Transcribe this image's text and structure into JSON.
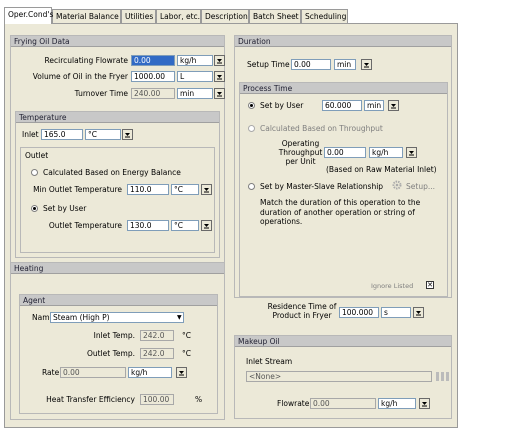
{
  "tabs": [
    "Oper.Cond's",
    "Material Balance",
    "Utilities",
    "Labor, etc.",
    "Description",
    "Batch Sheet",
    "Scheduling"
  ],
  "frying_oil": {
    "title": "Frying Oil Data",
    "recirc_label": "Recirculating Flowrate",
    "recirc_value": "0.00",
    "recirc_unit": "kg/h",
    "volume_label": "Volume of Oil in the Fryer",
    "volume_value": "1000.00",
    "volume_unit": "L",
    "turnover_label": "Turnover Time",
    "turnover_value": "240.00",
    "turnover_unit": "min"
  },
  "temperature": {
    "title": "Temperature",
    "inlet_label": "Inlet",
    "inlet_value": "165.0",
    "inlet_unit": "°C",
    "outlet_title": "Outlet",
    "calc_label": "Calculated Based on Energy Balance",
    "min_outlet_label": "Min Outlet Temperature",
    "min_outlet_value": "110.0",
    "min_outlet_unit": "°C",
    "set_user_label": "Set by User",
    "outlet_temp_label": "Outlet Temperature",
    "outlet_temp_value": "130.0",
    "outlet_temp_unit": "°C"
  },
  "heating": {
    "title": "Heating",
    "agent_title": "Agent",
    "name_label": "Name",
    "name_value": "Steam (High P)",
    "inlet_temp_label": "Inlet Temp.",
    "inlet_temp_value": "242.0",
    "inlet_temp_unit": "°C",
    "outlet_temp_label": "Outlet Temp.",
    "outlet_temp_value": "242.0",
    "outlet_temp_unit": "°C",
    "rate_label": "Rate",
    "rate_value": "0.00",
    "rate_unit": "kg/h",
    "eff_label": "Heat Transfer Efficiency",
    "eff_value": "100.00",
    "eff_unit": "%"
  },
  "duration": {
    "title": "Duration",
    "setup_label": "Setup Time",
    "setup_value": "0.00",
    "setup_unit": "min",
    "process_title": "Process Time",
    "set_user_label": "Set by User",
    "set_user_value": "60.000",
    "set_user_unit": "min",
    "calc_throughput_label": "Calculated Based on Throughput",
    "op_throughput_label": "Operating Throughput per Unit",
    "op_throughput_value": "0.00",
    "op_throughput_unit": "kg/h",
    "raw_basis_label": "(Based on Raw Material Inlet)",
    "master_slave_label": "Set by Master-Slave Relationship",
    "setup_button": "Setup...",
    "master_slave_desc": "Match the duration of this operation to the duration of another operation or string of operations.",
    "ignore_label": "Ignore Listed",
    "residence_label": "Residence Time of Product in Fryer",
    "residence_value": "100.000",
    "residence_unit": "s"
  },
  "makeup": {
    "title": "Makeup Oil",
    "inlet_stream_label": "Inlet Stream",
    "inlet_stream_value": "<None>",
    "flowrate_label": "Flowrate",
    "flowrate_value": "0.00",
    "flowrate_unit": "kg/h"
  }
}
